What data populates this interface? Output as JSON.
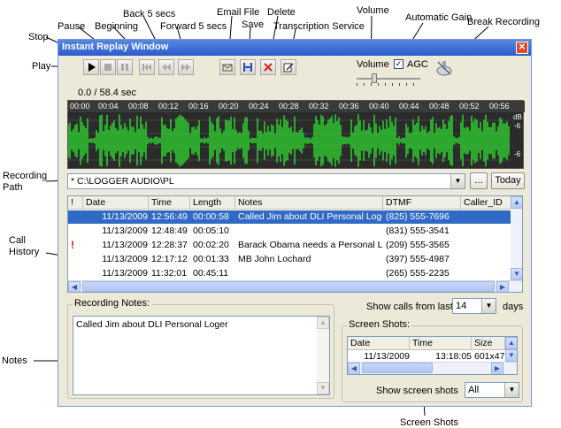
{
  "window": {
    "title": "Instant Replay Window"
  },
  "callouts": {
    "play": "Play",
    "stop": "Stop",
    "pause": "Pause",
    "beginning": "Beginning",
    "back5": "Back 5 secs",
    "forward5": "Forward 5 secs",
    "email": "Email File",
    "save": "Save",
    "delete": "Delete",
    "transcription": "Transcription Service",
    "volume": "Volume",
    "agc": "Automatic Gain",
    "break_recording": "Break Recording",
    "recording_path": "Recording Path",
    "call_history": "Call History",
    "notes": "Notes",
    "screen_shots": "Screen Shots"
  },
  "player": {
    "position": "0.0 / 58.4 sec",
    "volume_label": "Volume",
    "agc_label": "AGC",
    "agc_checked": true,
    "timeline": [
      "00:00",
      "00:04",
      "00:08",
      "00:12",
      "00:16",
      "00:20",
      "00:24",
      "00:28",
      "00:32",
      "00:36",
      "00:40",
      "00:44",
      "00:48",
      "00:52",
      "00:56"
    ],
    "db_top": "dB",
    "db_mid": "-6",
    "db_bot": "-6"
  },
  "path": {
    "value": "* C:\\LOGGER AUDIO\\PL",
    "browse_label": "...",
    "today_label": "Today"
  },
  "calls": {
    "headers": [
      "!",
      "Date",
      "Time",
      "Length",
      "Notes",
      "DTMF",
      "Caller_ID"
    ],
    "rows": [
      {
        "flag": "",
        "date": "11/13/2009",
        "time": "12:56:49",
        "length": "00:00:58",
        "notes": "Called Jim about DLI Personal Loger",
        "dtmf": "(825) 555-7696",
        "caller": "",
        "selected": true
      },
      {
        "flag": "",
        "date": "11/13/2009",
        "time": "12:48:49",
        "length": "00:05:10",
        "notes": "",
        "dtmf": "(831) 555-3541",
        "caller": "",
        "selected": false
      },
      {
        "flag": "!",
        "date": "11/13/2009",
        "time": "12:28:37",
        "length": "00:02:20",
        "notes": "Barack Obama needs a Personal L...",
        "dtmf": "(209) 555-3565",
        "caller": "",
        "selected": false
      },
      {
        "flag": "",
        "date": "11/13/2009",
        "time": "12:17:12",
        "length": "00:01:33",
        "notes": "MB  John Lochard",
        "dtmf": "(397) 555-4987",
        "caller": "",
        "selected": false
      },
      {
        "flag": "",
        "date": "11/13/2009",
        "time": "11:32:01",
        "length": "00:45:11",
        "notes": "",
        "dtmf": "(265) 555-2235",
        "caller": "",
        "selected": false
      }
    ]
  },
  "notes": {
    "label": "Recording Notes:",
    "text": "Called Jim about DLI Personal Loger"
  },
  "filter": {
    "show_calls_label": "Show calls from last",
    "days_value": "14",
    "days_label": "days"
  },
  "screenshots": {
    "label": "Screen Shots:",
    "headers": [
      "Date",
      "Time",
      "Size"
    ],
    "rows": [
      {
        "date": "11/13/2009",
        "time": "13:18:05",
        "size": "601x470"
      }
    ],
    "show_label": "Show screen shots",
    "show_value": "All"
  },
  "colors": {
    "wave": "#2fd12f",
    "waveform_bg": "#1c1c1c",
    "selection": "#316ac5",
    "titlebar": "#2a5bcf"
  }
}
